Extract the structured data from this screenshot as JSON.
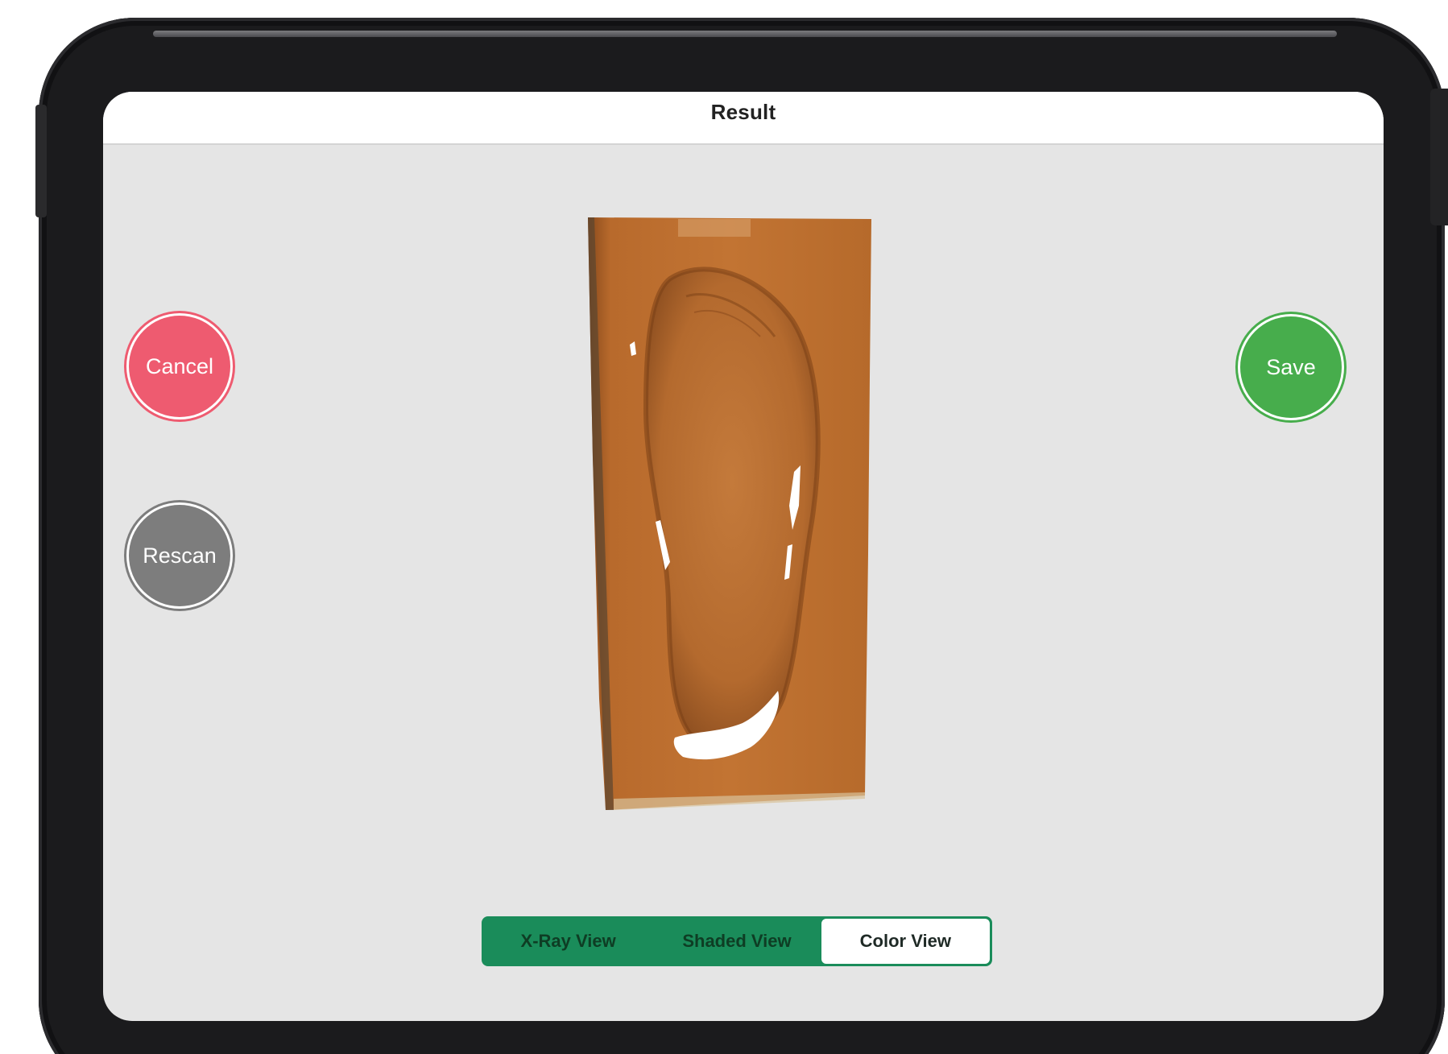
{
  "screen": {
    "title": "Result"
  },
  "actions": {
    "cancel_label": "Cancel",
    "rescan_label": "Rescan",
    "save_label": "Save"
  },
  "view_modes": {
    "options": [
      "X-Ray View",
      "Shaded View",
      "Color View"
    ],
    "selected": "Color View"
  },
  "colors": {
    "cancel": "#ee5b70",
    "rescan": "#7d7d7d",
    "save": "#47ad4c",
    "segment_accent": "#1a8c5a",
    "screen_background": "#e5e5e5"
  }
}
